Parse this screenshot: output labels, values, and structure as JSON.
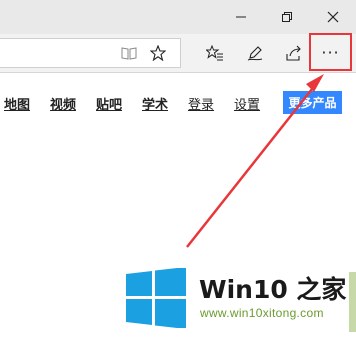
{
  "window": {
    "buttons": [
      "minimize",
      "restore",
      "close"
    ]
  },
  "toolbar": {
    "icons": [
      "reading-view-icon",
      "favorite-star-icon",
      "favorites-hub-icon",
      "pen-notes-icon",
      "share-icon"
    ],
    "more_label": "···"
  },
  "page": {
    "nav_links": [
      "地图",
      "视频",
      "贴吧",
      "学术",
      "登录",
      "设置"
    ],
    "more_products": "更多产品"
  },
  "annotation": {
    "color": "#e8363a"
  },
  "watermark": {
    "brand": "Win10 之家",
    "url": "www.win10xitong.com",
    "logo_color": "#1ba1e2"
  }
}
